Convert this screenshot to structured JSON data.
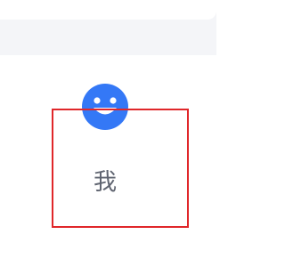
{
  "tab": {
    "label": "我",
    "icon": "smiley-face-icon",
    "icon_color": "#3478f6"
  },
  "annotation": {
    "color": "#e0272a"
  }
}
